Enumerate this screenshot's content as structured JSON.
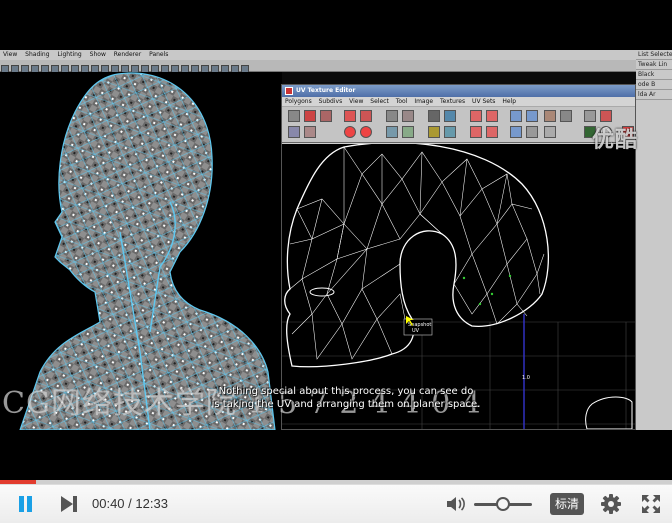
{
  "video": {
    "maya_menu": [
      "View",
      "Shading",
      "Lighting",
      "Show",
      "Renderer",
      "Panels"
    ],
    "uv_editor": {
      "title": "UV Texture Editor",
      "menu": [
        "Polygons",
        "Subdivs",
        "View",
        "Select",
        "Tool",
        "Image",
        "Textures",
        "UV Sets",
        "Help"
      ]
    },
    "side_panel": [
      "List  Selected",
      "Tweak Lin",
      "Black",
      "ode B",
      "lda Ar"
    ],
    "logo_text": "优酷",
    "site_watermark": "CG网络技术学院 1 5 7 2 4 4 0 4",
    "subtitle_line1": "Nothing special about this process, you can see do",
    "subtitle_line2": "is taking the UV and arranging them on planer space.",
    "uv_label": "Snapshot\nUV"
  },
  "player": {
    "current_time": "00:40",
    "duration": "12:33",
    "time_separator": " / ",
    "progress_fraction": 0.0531,
    "volume_fraction": 0.5,
    "quality_label": "标清"
  },
  "colors": {
    "accent": "#1aa0e6",
    "progress": "#e23c2e",
    "mesh_3d": "#5ec8f0",
    "uv_wire": "#ffffff"
  }
}
